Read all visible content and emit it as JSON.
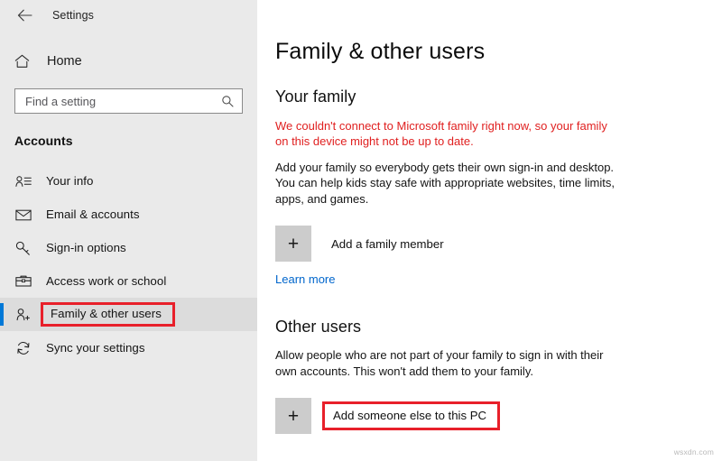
{
  "window": {
    "app_title": "Settings",
    "back_icon": "back-arrow-icon"
  },
  "sidebar": {
    "home": {
      "label": "Home",
      "icon": "home-icon"
    },
    "search": {
      "placeholder": "Find a setting",
      "value": "",
      "icon": "search-icon"
    },
    "section_title": "Accounts",
    "items": [
      {
        "label": "Your info",
        "icon": "contact-card-icon",
        "selected": false
      },
      {
        "label": "Email & accounts",
        "icon": "envelope-icon",
        "selected": false
      },
      {
        "label": "Sign-in options",
        "icon": "key-icon",
        "selected": false
      },
      {
        "label": "Access work or school",
        "icon": "briefcase-icon",
        "selected": false
      },
      {
        "label": "Family & other users",
        "icon": "add-user-icon",
        "selected": true
      },
      {
        "label": "Sync your settings",
        "icon": "sync-icon",
        "selected": false
      }
    ]
  },
  "main": {
    "page_title": "Family & other users",
    "your_family": {
      "heading": "Your family",
      "error": "We couldn't connect to Microsoft family right now, so your family on this device might not be up to date.",
      "description": "Add your family so everybody gets their own sign-in and desktop. You can help kids stay safe with appropriate websites, time limits, apps, and games.",
      "add_button": "Add a family member",
      "add_icon": "plus-icon",
      "learn_more": "Learn more"
    },
    "other_users": {
      "heading": "Other users",
      "description": "Allow people who are not part of your family to sign in with their own accounts. This won't add them to your family.",
      "add_button": "Add someone else to this PC",
      "add_icon": "plus-icon"
    }
  },
  "watermark": "wsxdn.com",
  "colors": {
    "accent": "#0078d7",
    "highlight": "#e8202a",
    "error_text": "#e02020",
    "link": "#0066cc",
    "sidebar_bg": "#eaeaea",
    "selected_row_bg": "#dcdcdc",
    "plus_button_bg": "#cccccc"
  }
}
